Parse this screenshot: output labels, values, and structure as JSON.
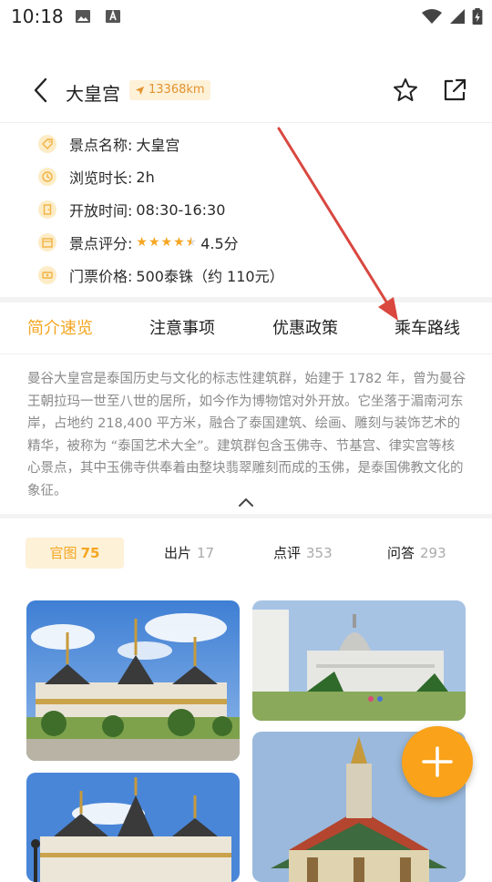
{
  "status_bar": {
    "time": "10:18"
  },
  "header": {
    "title": "大皇宫",
    "distance": "13368km"
  },
  "info": [
    {
      "label": "景点名称:",
      "value": "大皇宫",
      "icon": "tag-icon"
    },
    {
      "label": "浏览时长:",
      "value": "2h",
      "icon": "clock-icon"
    },
    {
      "label": "开放时间:",
      "value": "08:30-16:30",
      "icon": "door-icon"
    },
    {
      "label": "景点评分:",
      "value": "4.5分",
      "icon": "calendar-icon",
      "rating": 4.5
    },
    {
      "label": "门票价格:",
      "value": "500泰铢（约 110元）",
      "icon": "ticket-icon"
    }
  ],
  "tabs": [
    "简介速览",
    "注意事项",
    "优惠政策",
    "乘车路线"
  ],
  "intro": "曼谷大皇宫是泰国历史与文化的标志性建筑群，始建于 1782 年，曾为曼谷王朝拉玛一世至八世的居所，如今作为博物馆对外开放。它坐落于湄南河东岸，占地约 218,400 平方米，融合了泰国建筑、绘画、雕刻与装饰艺术的精华，被称为 “泰国艺术大全”。建筑群包含玉佛寺、节基宫、律实宫等核心景点，其中玉佛寺供奉着由整块翡翠雕刻而成的玉佛，是泰国佛教文化的象征。",
  "filters": [
    {
      "label": "官图",
      "count": "75"
    },
    {
      "label": "出片",
      "count": "17"
    },
    {
      "label": "点评",
      "count": "353"
    },
    {
      "label": "问答",
      "count": "293"
    }
  ],
  "colors": {
    "accent": "#f5a623",
    "annotation_arrow": "#d9473f"
  }
}
